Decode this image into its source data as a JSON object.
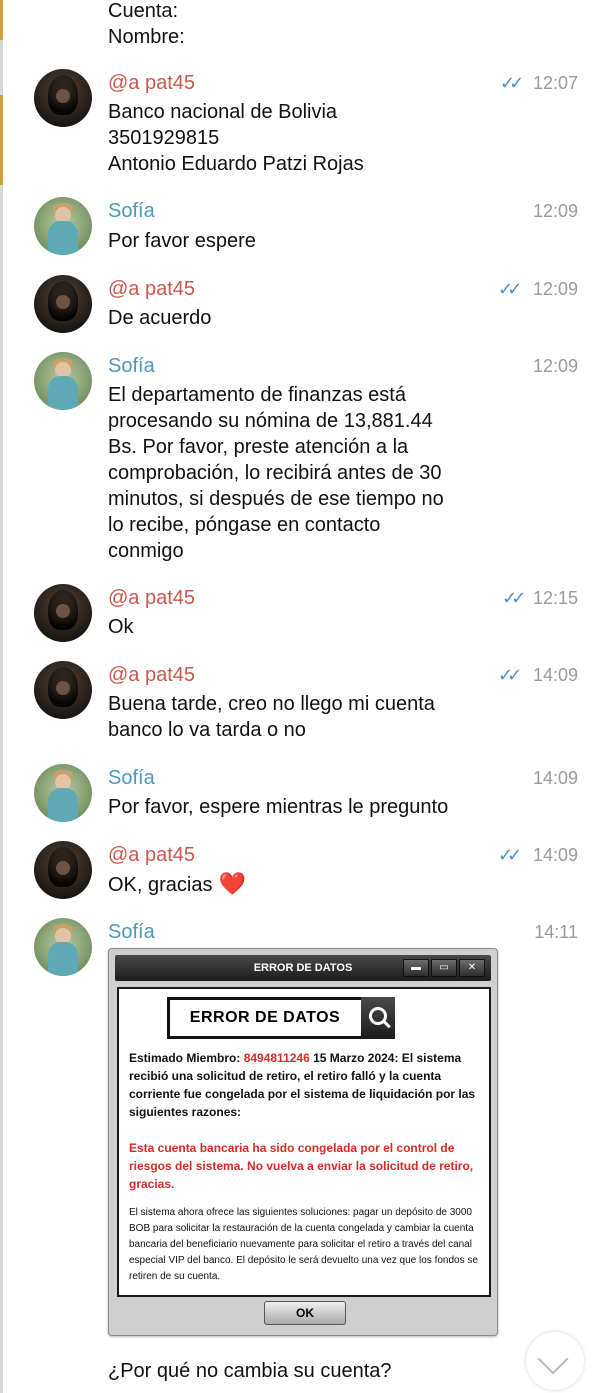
{
  "messages": {
    "m0": {
      "lines": [
        "Cuenta:",
        "Nombre:"
      ]
    },
    "m1": {
      "sender": "@a pat45",
      "time": "12:07",
      "ticks": "✓✓",
      "lines": [
        "Banco nacional de Bolivia",
        "3501929815",
        "Antonio Eduardo Patzi Rojas"
      ]
    },
    "m2": {
      "sender": "Sofía",
      "time": "12:09",
      "lines": [
        "Por favor espere"
      ]
    },
    "m3": {
      "sender": "@a pat45",
      "time": "12:09",
      "ticks": "✓✓",
      "lines": [
        "De acuerdo"
      ]
    },
    "m4": {
      "sender": "Sofía",
      "time": "12:09",
      "lines": [
        "El departamento de finanzas está",
        "procesando su nómina de 13,881.44",
        "Bs. Por favor, preste atención a la",
        "comprobación, lo recibirá antes de 30",
        "minutos, si después de ese tiempo no",
        "lo recibe, póngase en contacto",
        "conmigo"
      ]
    },
    "m5": {
      "sender": "@a pat45",
      "time": "12:15",
      "ticks": "✓✓",
      "lines": [
        "Ok"
      ]
    },
    "m6": {
      "sender": "@a pat45",
      "time": "14:09",
      "ticks": "✓✓",
      "lines": [
        "Buena tarde, creo no llego mi  cuenta",
        "banco lo va tarda o no"
      ]
    },
    "m7": {
      "sender": "Sofía",
      "time": "14:09",
      "lines": [
        "Por favor, espere mientras le pregunto"
      ]
    },
    "m8": {
      "sender": "@a pat45",
      "time": "14:09",
      "ticks": "✓✓",
      "lines": [
        "OK, gracias"
      ],
      "emoji": "❤️"
    },
    "m9": {
      "sender": "Sofía",
      "time": "14:11"
    },
    "m10": {
      "lines": [
        "¿Por qué no cambia su cuenta?"
      ]
    }
  },
  "error_image": {
    "window_title": "ERROR DE DATOS",
    "window_buttons": [
      "▬",
      "▭",
      "✕"
    ],
    "header": "ERROR DE DATOS",
    "p1_prefix": "Estimado Miembro: ",
    "p1_number": "8494811246",
    "p1_rest": "  15 Marzo 2024: El sistema recibió una solicitud de retiro, el retiro falló y la cuenta corriente fue congelada por el sistema de liquidación por las siguientes razones:",
    "p2": "Esta cuenta bancaria ha sido congelada por el control de riesgos del sistema. No vuelva a enviar la solicitud de retiro, gracias.",
    "p3": "El sistema ahora ofrece las siguientes soluciones: pagar un depósito de 3000 BOB para solicitar la restauración de la cuenta congelada y cambiar la cuenta bancaria del beneficiario nuevamente para solicitar el retiro a través del canal especial VIP del banco. El depósito le será devuelto una vez que los fondos se retiren de su cuenta.",
    "ok_label": "OK"
  },
  "icons": {
    "scroll_down": "chevron-down-icon",
    "search": "search-icon"
  }
}
